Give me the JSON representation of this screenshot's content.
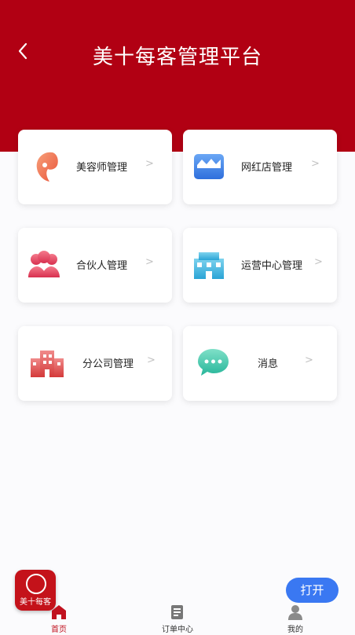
{
  "header": {
    "title": "美十每客管理平台",
    "back_icon": "chevron-left-icon",
    "background_color": "#b10013"
  },
  "menu": [
    {
      "label": "美容师管理",
      "icon": "beautician-icon",
      "chevron": ">"
    },
    {
      "label": "网红店管理",
      "icon": "shop-icon",
      "chevron": ">"
    },
    {
      "label": "合伙人管理",
      "icon": "partners-icon",
      "chevron": ">"
    },
    {
      "label": "运营中心管理",
      "icon": "operation-center-icon",
      "chevron": ">"
    },
    {
      "label": "分公司管理",
      "icon": "branch-office-icon",
      "chevron": ">"
    },
    {
      "label": "消息",
      "icon": "message-icon",
      "chevron": ">"
    }
  ],
  "tabbar": {
    "items": [
      {
        "label": "首页",
        "icon": "home-icon",
        "active": true
      },
      {
        "label": "订单中心",
        "icon": "order-icon",
        "active": false
      },
      {
        "label": "我的",
        "icon": "profile-icon",
        "active": false
      }
    ],
    "active_color": "#c1121f"
  },
  "promo": {
    "app_logo_text": "美十每客",
    "open_button": "打开",
    "open_button_color": "#3a78f2"
  }
}
